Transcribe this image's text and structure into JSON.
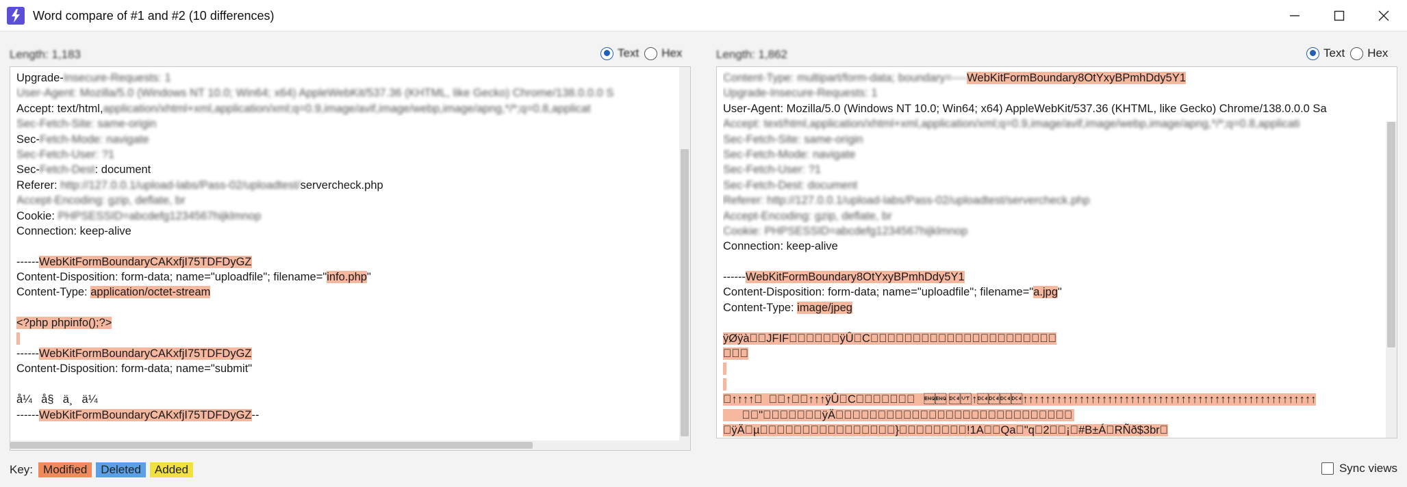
{
  "window": {
    "title": "Word compare of #1 and #2  (10 differences)"
  },
  "left_panel": {
    "length_label": "Length: 1,183",
    "radio_text": "Text",
    "radio_hex": "Hex",
    "selected": "Text",
    "lines": [
      [
        {
          "t": "Upgrade-"
        },
        {
          "t": "Insecure-Requests: 1",
          "c": "blur"
        }
      ],
      [
        {
          "t": "User-Agent: Mozilla/5.0 (Windows NT 10.0; Win64; x64) AppleWebKit/537.36 (KHTML, like Gecko) Chrome/138.0.0.0 S",
          "c": "blur"
        }
      ],
      [
        {
          "t": "Accept: text/html,"
        },
        {
          "t": "application/xhtml+xml,application/xml;q=0.9,image/avif,image/webp,image/apng,*/*;q=0.8,applicat",
          "c": "blur"
        }
      ],
      [
        {
          "t": "Sec-Fetch-Site: same-origin",
          "c": "blur"
        }
      ],
      [
        {
          "t": "Sec-"
        },
        {
          "t": "Fetch-Mode: navigate",
          "c": "blur"
        }
      ],
      [
        {
          "t": "Sec-Fetch-User: ?1",
          "c": "blur"
        }
      ],
      [
        {
          "t": "Sec-"
        },
        {
          "t": "Fetch-Dest",
          "c": "blur"
        },
        {
          "t": ": document"
        }
      ],
      [
        {
          "t": "Referer: "
        },
        {
          "t": "http://127.0.0.1/upload-labs/Pass-02/uploadtest/",
          "c": "blur"
        },
        {
          "t": "servercheck.php"
        }
      ],
      [
        {
          "t": "Accept-Encoding: gzip, deflate, br",
          "c": "blur"
        }
      ],
      [
        {
          "t": "Cookie: "
        },
        {
          "t": "PHPSESSID=abcdefg1234567hijklmnop",
          "c": "blur"
        }
      ],
      [
        {
          "t": "Connection: keep-alive"
        }
      ],
      [
        {
          "t": ""
        }
      ],
      [
        {
          "t": "------"
        },
        {
          "t": "WebKitFormBoundaryCAKxfjI75TDFDyGZ",
          "c": "mod"
        }
      ],
      [
        {
          "t": "Content-Disposition: form-data; name=\"uploadfile\"; filename=\""
        },
        {
          "t": "info.php",
          "c": "mod"
        },
        {
          "t": "\""
        }
      ],
      [
        {
          "t": "Content-Type: "
        },
        {
          "t": "application/octet-stream",
          "c": "mod"
        }
      ],
      [
        {
          "t": ""
        }
      ],
      [
        {
          "t": "<?php phpinfo();?>",
          "c": "mod"
        }
      ],
      [
        {
          "t": " ",
          "c": "mod"
        }
      ],
      [
        {
          "t": "------"
        },
        {
          "t": "WebKitFormBoundaryCAKxfjI75TDFDyGZ",
          "c": "mod"
        }
      ],
      [
        {
          "t": "Content-Disposition: form-data; name=\"submit\""
        }
      ],
      [
        {
          "t": ""
        }
      ],
      [
        {
          "t": "å¼å§ä¸ä¼ "
        }
      ],
      [
        {
          "t": "------"
        },
        {
          "t": "WebKitFormBoundaryCAKxfjI75TDFDyGZ",
          "c": "mod"
        },
        {
          "t": "--"
        }
      ]
    ]
  },
  "right_panel": {
    "length_label": "Length: 1,862",
    "radio_text": "Text",
    "radio_hex": "Hex",
    "selected": "Text",
    "lines": [
      [
        {
          "t": "Content-Type: multipart/form-data; boundary=----",
          "c": "blur"
        },
        {
          "t": "WebKitFormBoundary8OtYxyBPmhDdy5Y1",
          "c": "mod"
        }
      ],
      [
        {
          "t": "Upgrade-Insecure-Requests: 1",
          "c": "blur"
        }
      ],
      [
        {
          "t": "User-Agent: Mozilla/5.0 (Windows NT 10.0; Win64; x64) AppleWebKit/537.36 (KHTML, like Gecko) Chrome/138.0.0.0 Sa"
        }
      ],
      [
        {
          "t": "Accept: text/html,application/xhtml+xml,application/xml;q=0.9,image/avif,image/webp,image/apng,*/*;q=0.8,applicati",
          "c": "blur"
        }
      ],
      [
        {
          "t": "Sec-Fetch-Site: same-origin",
          "c": "blur"
        }
      ],
      [
        {
          "t": "Sec-Fetch-Mode: navigate",
          "c": "blur"
        }
      ],
      [
        {
          "t": "Sec-Fetch-User: ?1",
          "c": "blur"
        }
      ],
      [
        {
          "t": "Sec-Fetch-Dest: document",
          "c": "blur"
        }
      ],
      [
        {
          "t": "Referer: http://127.0.0.1/upload-labs/Pass-02/uploadtest/servercheck.php",
          "c": "blur"
        }
      ],
      [
        {
          "t": "Accept-Encoding: gzip, deflate, br",
          "c": "blur"
        }
      ],
      [
        {
          "t": "Cookie: PHPSESSID=abcdefg1234567hijklmnop",
          "c": "blur"
        }
      ],
      [
        {
          "t": "Connection: keep-alive"
        }
      ],
      [
        {
          "t": ""
        }
      ],
      [
        {
          "t": "------"
        },
        {
          "t": "WebKitFormBoundary8OtYxyBPmhDdy5Y1",
          "c": "mod"
        }
      ],
      [
        {
          "t": "Content-Disposition: form-data; name=\"uploadfile\"; filename=\""
        },
        {
          "t": "a.jpg",
          "c": "mod"
        },
        {
          "t": "\""
        }
      ],
      [
        {
          "t": "Content-Type: "
        },
        {
          "t": "image/jpeg",
          "c": "mod"
        }
      ],
      [
        {
          "t": ""
        }
      ],
      [
        {
          "t": "ÿØÿà\u0000\u0010JFIF\u0000\u0001\u0001\u0001\u0000\u0000ÿÛ\u0000C\u0000\u0003\u0002\u0002\u0003\u0002\u0002\u0003\u0003\u0003\u0003\u0004\u0003\u0003\u0004\u0005\b\u0005\u0005\u0004\u0004\u0005\n\u0007\u0007\u0006\b\f\n\f\f\u000b\n\u000b\u000b\r\u000e\u0012\u0010\r\u000e\u0011\u000e\u000b\u000b\u0010\u0016\u0010\u0011\u0013\u0014\u0015\u0015\u0015\f\u000f\u0017\u0018\u0016\u0014\u0018\u0012\u0014\u0015\u0014  \u0000   \u0000\u0000",
          "c": "mod"
        }
      ],
      [
        {
          "t": "\u0000\u0000\u0000",
          "c": "mod"
        }
      ],
      [
        {
          "t": " ",
          "c": "mod"
        }
      ],
      [
        {
          "t": " ",
          "c": "mod"
        }
      ],
      [
        {
          "t": "\u0000↑↑↑↑\u0000  \u0000\u0000↑\u0000\u0000↑↑↑ÿÛ\u0000C\u0001\u0003\u0004\u0004\u0005\u0004\u0005\t\u0005\u0005\t\u0014\r\u000b\r↑\u0014\u0014\u0014\u0014↑↑↑↑↑↑↑↑↑↑↑↑↑↑↑↑↑↑↑↑↑↑↑↑↑↑↑↑↑↑↑↑↑↑↑↑↑↑↑↑↑↑↑↑↑↑↑↑↑↑↑↑",
          "c": "mod"
        }
      ],
      [
        {
          "t": "      \u0000\u0000\"\u0000\u0001\u0011\u0001\u0002\u0011\u0001ÿÄ\u0000\u001f\u0000\u0000\u0001\u0005\u0001\u0001\u0001\u0001\u0001\u0001\u0000\u0000\u0000\u0000\u0000\u0000\u0000\u0000\u0001\u0002\u0003\u0004\u0005\u0006\u0007\b\t\n\u000b     ",
          "c": "mod"
        }
      ],
      [
        {
          "t": "\u0000ÿÄ\u0000µ\u0010\u0000\u0002\u0001\u0003\u0003\u0002\u0004\u0003\u0005\u0005\u0004\u0004\u0000\u0000\u0001}\u0001\u0002\u0003\u0000\u0004\u0011\u0005\u0012!1A\u0006\u0013Qa\u0007\"q\u00142¡\b#B±Á\u0015RÑð$3br",
          "c": "mod"
        }
      ]
    ]
  },
  "key": {
    "label": "Key:",
    "modified": "Modified",
    "deleted": "Deleted",
    "added": "Added",
    "colors": {
      "modified": "#f08a5d",
      "deleted": "#5aa0e6",
      "added": "#f0e040"
    }
  },
  "sync": {
    "label": "Sync views",
    "checked": false
  }
}
